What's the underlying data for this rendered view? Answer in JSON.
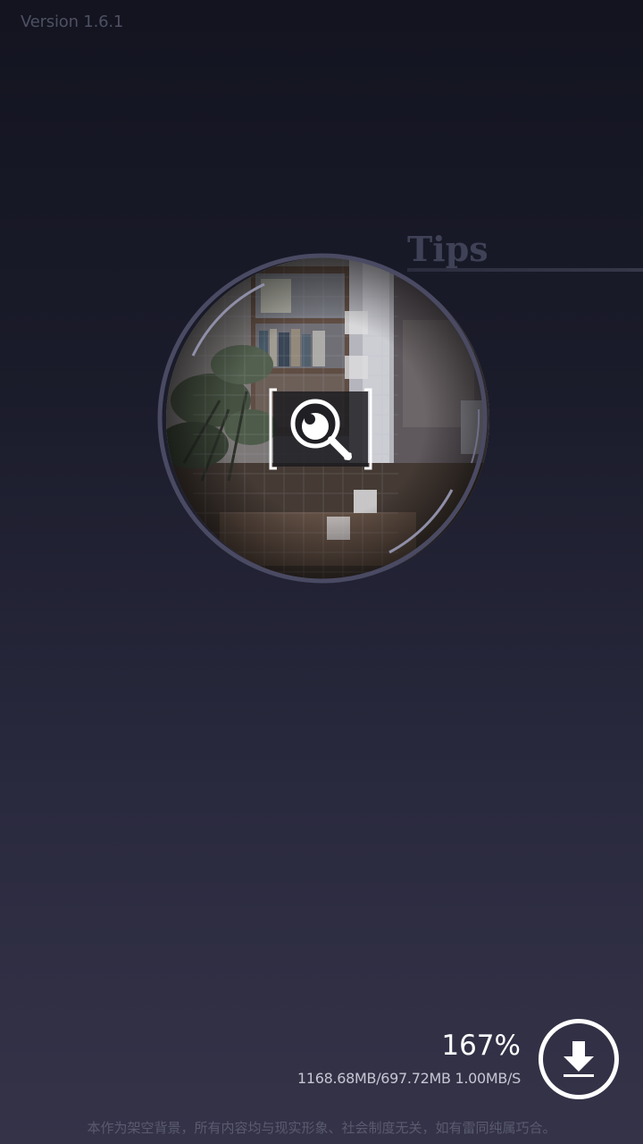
{
  "header": {
    "version": "Version 1.6.1"
  },
  "tips": {
    "title": "Tips"
  },
  "loader": {
    "progress": "167%",
    "size_info": "1168.68MB/697.72MB 1.00MB/S",
    "download_icon": "download-icon"
  },
  "footer": {
    "disclaimer": "本作为架空背景，所有内容均与现实形象、社会制度无关，如有雷同纯属巧合。"
  },
  "icons": {
    "magnifier": "magnifier-icon"
  },
  "colors": {
    "accent": "#ffffff",
    "ring": "#4a4a63"
  }
}
